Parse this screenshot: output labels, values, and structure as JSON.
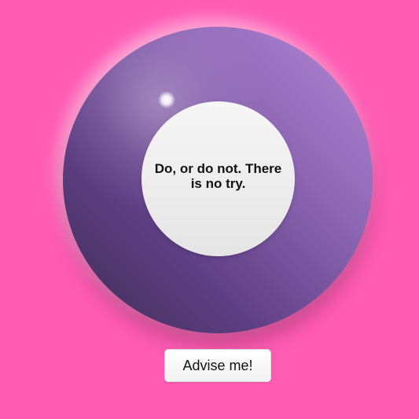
{
  "magic_ball": {
    "answer": "Do, or do not. There is no try."
  },
  "controls": {
    "advise_label": "Advise me!"
  },
  "colors": {
    "background": "#ff5bb3",
    "ball_light": "#b488d8",
    "ball_dark": "#3c2b4f",
    "window": "#f0f0f0"
  }
}
